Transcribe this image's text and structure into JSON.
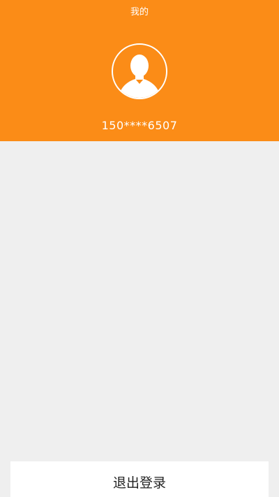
{
  "header": {
    "title": "我的",
    "phone": "150****6507",
    "avatar_icon": "user-silhouette-icon",
    "background_color": "#fb8c17"
  },
  "actions": {
    "logout_label": "退出登录"
  }
}
